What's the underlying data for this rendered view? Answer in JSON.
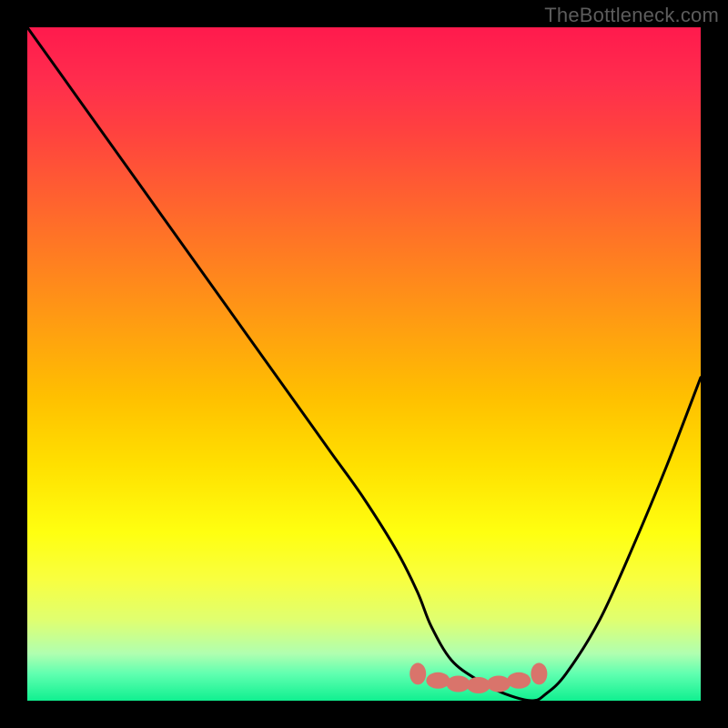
{
  "watermark": "TheBottleneck.com",
  "chart_data": {
    "type": "line",
    "title": "",
    "xlabel": "",
    "ylabel": "",
    "xlim": [
      0,
      100
    ],
    "ylim": [
      0,
      100
    ],
    "series": [
      {
        "name": "curve",
        "x": [
          0,
          5,
          10,
          15,
          20,
          25,
          30,
          35,
          40,
          45,
          50,
          55,
          58,
          60,
          63,
          67,
          71,
          75,
          77,
          80,
          85,
          90,
          95,
          100
        ],
        "y": [
          100,
          93,
          86,
          79,
          72,
          65,
          58,
          51,
          44,
          37,
          30,
          22,
          16,
          11,
          6,
          3,
          1,
          0,
          1,
          4,
          12,
          23,
          35,
          48
        ]
      },
      {
        "name": "highlight-dots",
        "x": [
          58,
          61,
          64,
          67,
          70,
          73,
          76
        ],
        "y": [
          4,
          3,
          2.5,
          2.3,
          2.5,
          3,
          4
        ]
      }
    ],
    "colors": {
      "curve": "#000000",
      "highlight": "#d9746b"
    }
  }
}
